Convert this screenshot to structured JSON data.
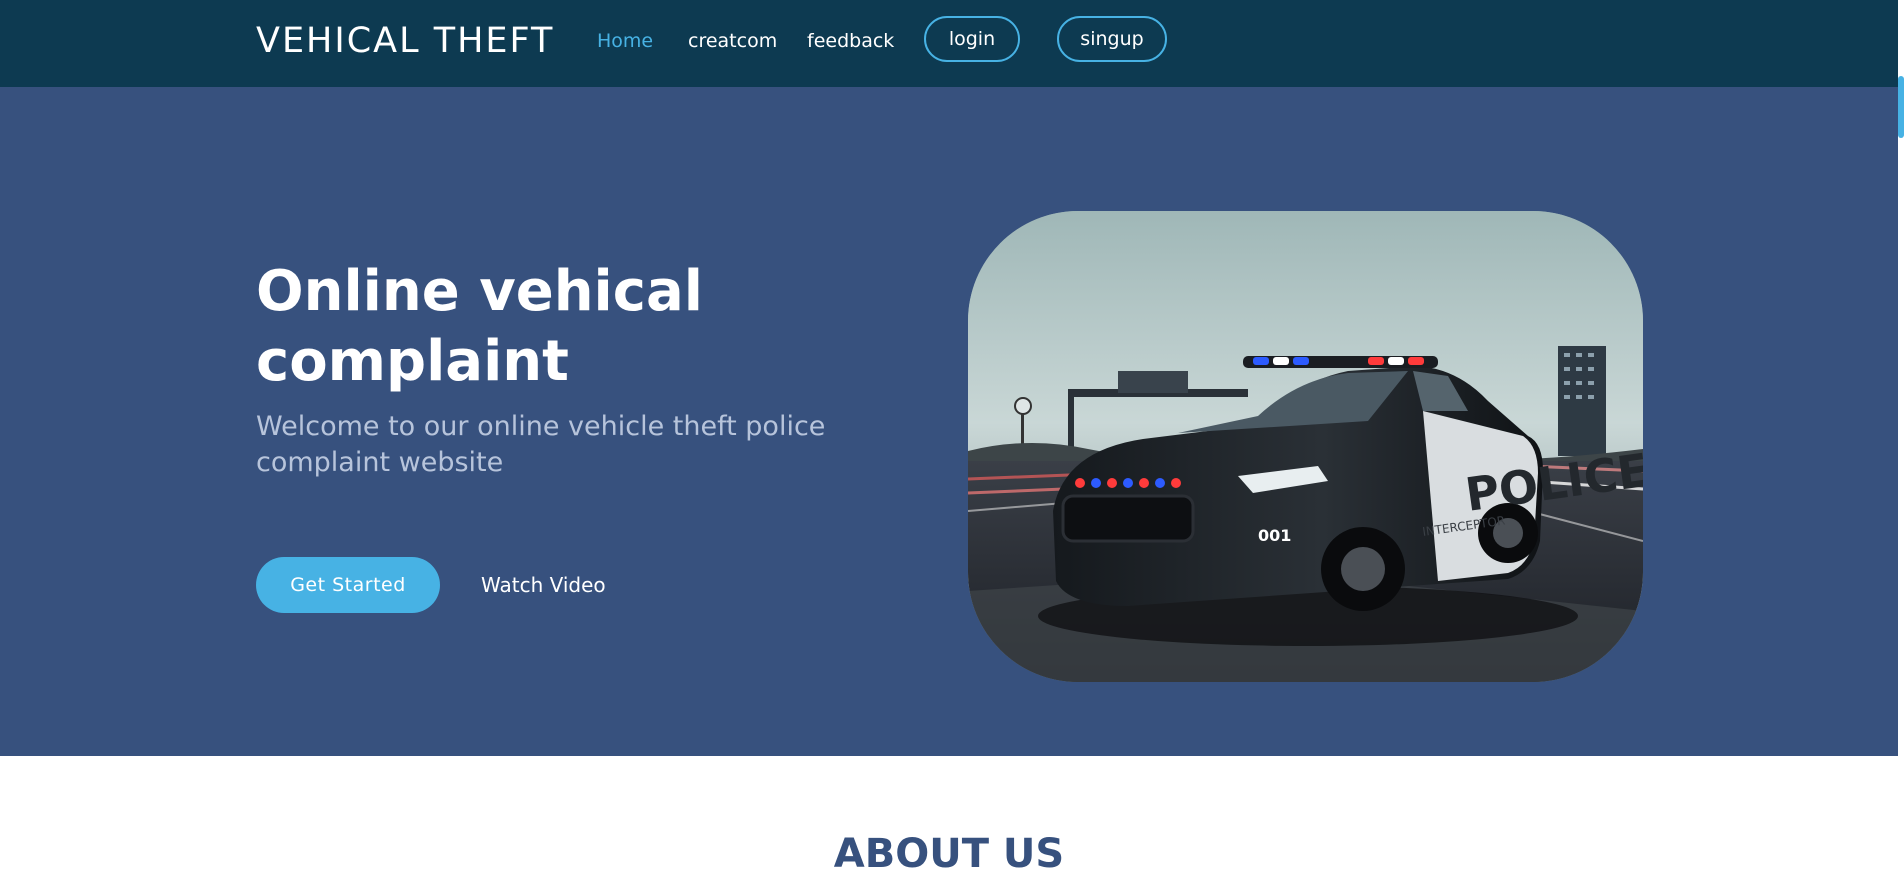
{
  "header": {
    "brand": "VEHICAL THEFT",
    "nav": [
      {
        "label": "Home",
        "active": true
      },
      {
        "label": "creatcom",
        "active": false
      },
      {
        "label": "feedback",
        "active": false
      }
    ],
    "login_label": "login",
    "signup_label": "singup"
  },
  "hero": {
    "title": "Online vehical complaint",
    "subtitle": "Welcome to our online vehicle theft police complaint website",
    "cta_label": "Get Started",
    "video_label": "Watch Video",
    "image": {
      "subject": "police-car",
      "door_text": "POLICE",
      "unit_number": "001",
      "side_text": "INTERCEPTOR"
    }
  },
  "about": {
    "title": "ABOUT US"
  },
  "colors": {
    "header_bg": "#0d3a51",
    "hero_bg": "#37517e",
    "accent": "#47b2e4",
    "subtitle": "#b7c4db",
    "about_title": "#37517e"
  }
}
